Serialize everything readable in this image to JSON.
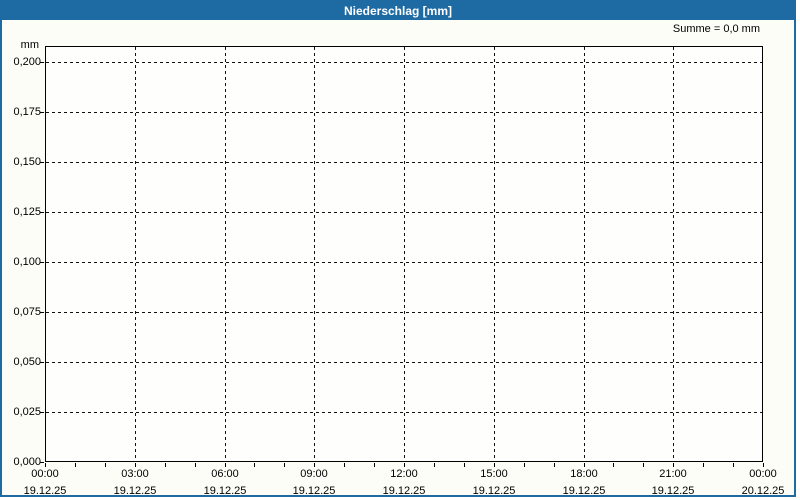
{
  "window": {
    "title": "Niederschlag [mm]",
    "summary": "Summe = 0,0 mm"
  },
  "colors": {
    "titlebar_bg": "#1e6ba4",
    "window_border": "#1e6ba4",
    "titlebar_text": "#ffffff",
    "axis_text": "#000000",
    "gridline": "#111111",
    "panel_bg": "#fdfdf8",
    "plot_bg": "#fefefc"
  },
  "chart_data": {
    "type": "bar",
    "title": "Niederschlag [mm]",
    "xlabel": "",
    "ylabel": "mm",
    "ylim": [
      0.0,
      0.208
    ],
    "grid": "dashed",
    "legend_position": "none",
    "annotation": "Summe = 0,0 mm",
    "sum_value_mm": "0,0",
    "series": [
      {
        "name": "Niederschlag",
        "values": []
      }
    ],
    "y_axis": {
      "unit": "mm",
      "tick_labels": [
        "0,200",
        "0,175",
        "0,150",
        "0,125",
        "0,100",
        "0,075",
        "0,050",
        "0,025",
        "0,000"
      ],
      "tick_values": [
        0.2,
        0.175,
        0.15,
        0.125,
        0.1,
        0.075,
        0.05,
        0.025,
        0.0
      ]
    },
    "x_axis": {
      "range": "19.12.25 00:00 - 20.12.25 00:00",
      "minor_tick_interval_hours": 1,
      "major_tick_interval_hours": 3,
      "ticks": [
        {
          "time": "00:00",
          "date": "19.12.25"
        },
        {
          "time": "03:00",
          "date": "19.12.25"
        },
        {
          "time": "06:00",
          "date": "19.12.25"
        },
        {
          "time": "09:00",
          "date": "19.12.25"
        },
        {
          "time": "12:00",
          "date": "19.12.25"
        },
        {
          "time": "15:00",
          "date": "19.12.25"
        },
        {
          "time": "18:00",
          "date": "19.12.25"
        },
        {
          "time": "21:00",
          "date": "19.12.25"
        },
        {
          "time": "00:00",
          "date": "20.12.25"
        }
      ]
    }
  }
}
